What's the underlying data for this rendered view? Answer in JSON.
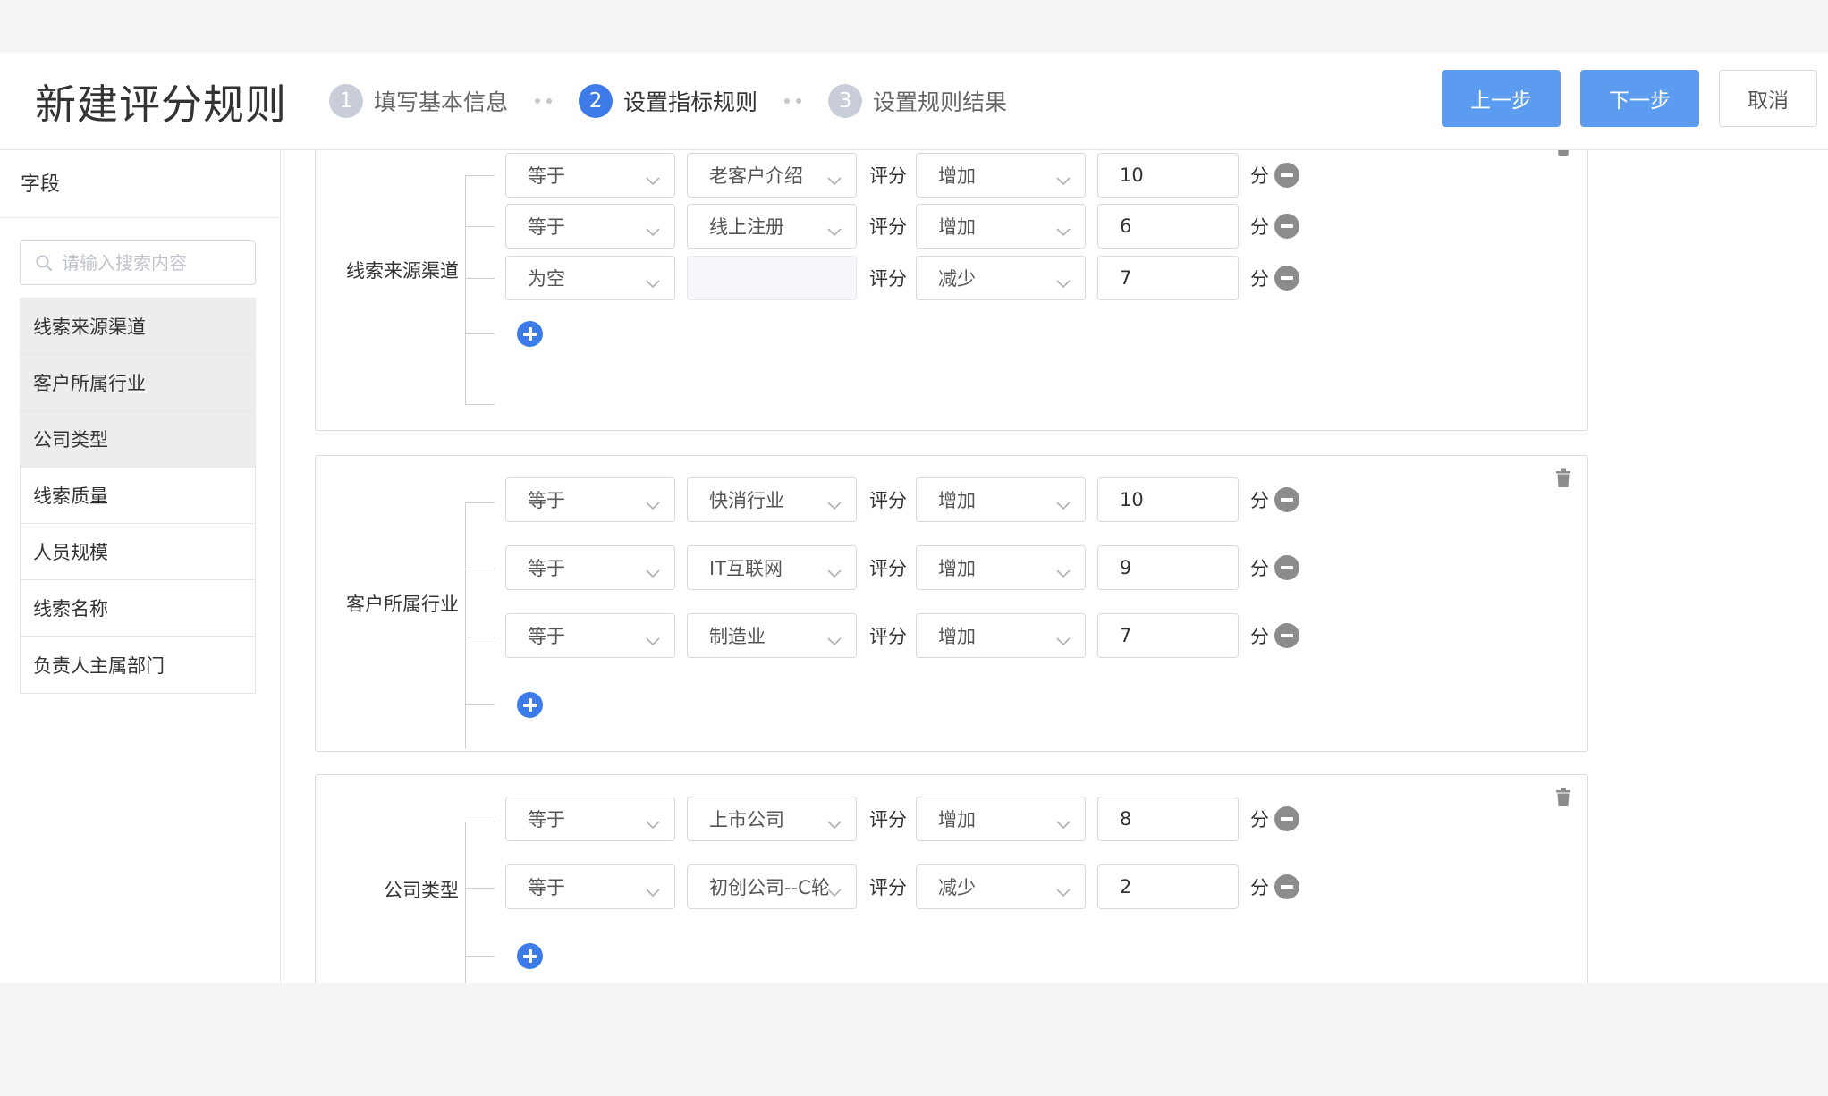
{
  "header": {
    "title": "新建评分规则",
    "steps": [
      {
        "num": "1",
        "label": "填写基本信息"
      },
      {
        "num": "2",
        "label": "设置指标规则"
      },
      {
        "num": "3",
        "label": "设置规则结果"
      }
    ],
    "prev_label": "上一步",
    "next_label": "下一步",
    "cancel_label": "取消"
  },
  "colors": {
    "primary": "#3d7be8",
    "primary_button": "#5b9cf1",
    "step_inactive": "#c9cdd8",
    "minus": "#8c8c8c"
  },
  "sidebar": {
    "title": "字段",
    "search_placeholder": "请输入搜索内容",
    "fields": [
      {
        "label": "线索来源渠道",
        "used": true
      },
      {
        "label": "客户所属行业",
        "used": true
      },
      {
        "label": "公司类型",
        "used": true
      },
      {
        "label": "线索质量",
        "used": false
      },
      {
        "label": "人员规模",
        "used": false
      },
      {
        "label": "线索名称",
        "used": false
      },
      {
        "label": "负责人主属部门",
        "used": false
      }
    ]
  },
  "common": {
    "score_label": "评分",
    "unit_label": "分"
  },
  "rule_groups": [
    {
      "field": "线索来源渠道",
      "rules": [
        {
          "operator": "等于",
          "value": "老客户介绍",
          "action": "增加",
          "points": "10"
        },
        {
          "operator": "等于",
          "value": "线上注册",
          "action": "增加",
          "points": "6"
        },
        {
          "operator": "为空",
          "value": "",
          "action": "减少",
          "points": "7"
        }
      ]
    },
    {
      "field": "客户所属行业",
      "rules": [
        {
          "operator": "等于",
          "value": "快消行业",
          "action": "增加",
          "points": "10"
        },
        {
          "operator": "等于",
          "value": "IT互联网",
          "action": "增加",
          "points": "9"
        },
        {
          "operator": "等于",
          "value": "制造业",
          "action": "增加",
          "points": "7"
        }
      ]
    },
    {
      "field": "公司类型",
      "rules": [
        {
          "operator": "等于",
          "value": "上市公司",
          "action": "增加",
          "points": "8"
        },
        {
          "operator": "等于",
          "value": "初创公司--C轮",
          "action": "减少",
          "points": "2"
        }
      ]
    }
  ]
}
